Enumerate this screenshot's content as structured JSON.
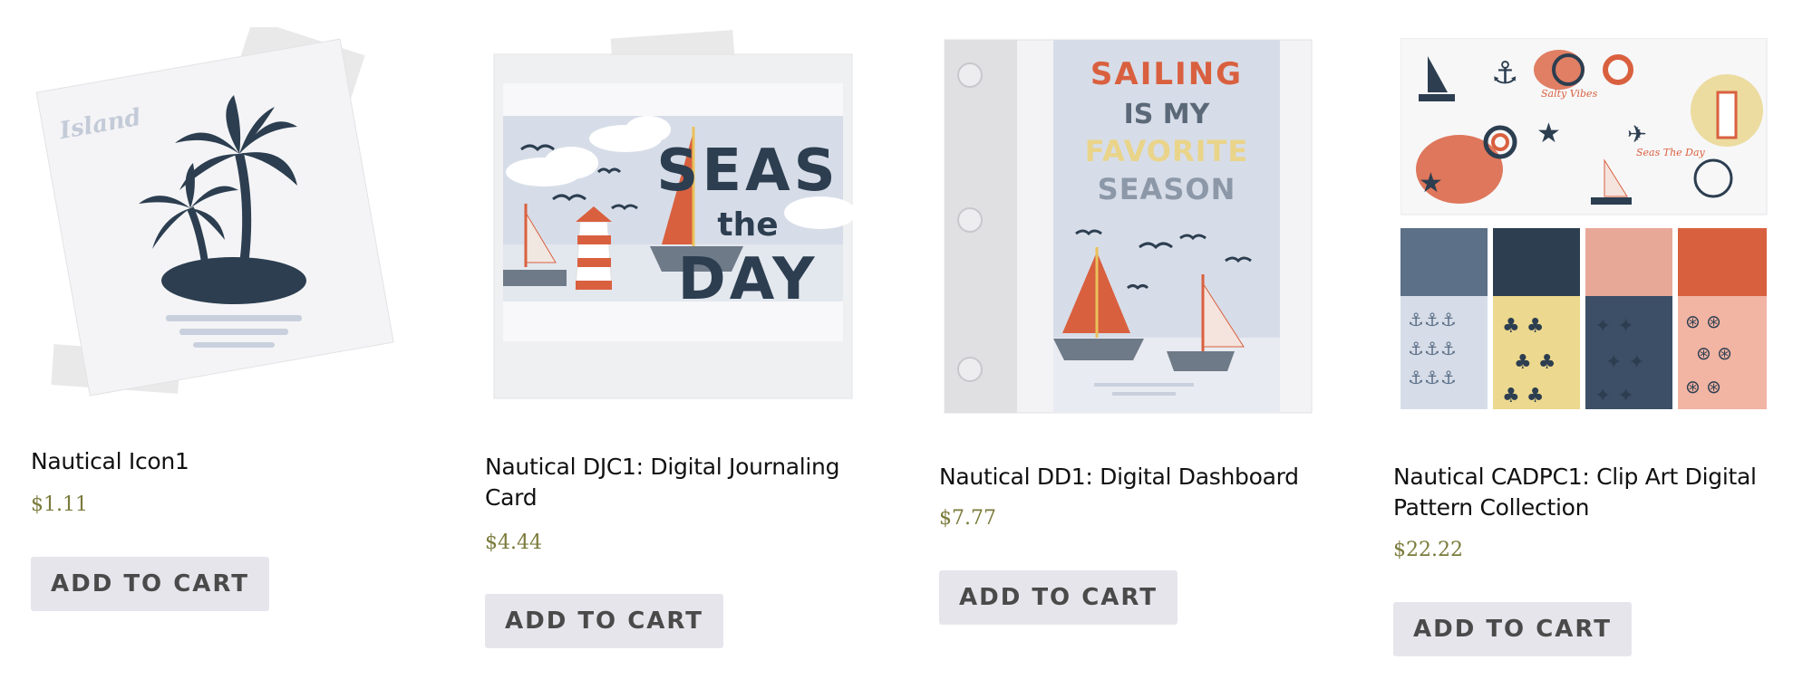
{
  "products": [
    {
      "title": "Nautical Icon1",
      "price": "$1.11",
      "button": "ADD TO CART",
      "image_text": "Island"
    },
    {
      "title": "Nautical DJC1: Digital Journaling Card",
      "price": "$4.44",
      "button": "ADD TO CART",
      "image_text": {
        "line1": "SEAS",
        "line2": "the",
        "line3": "DAY"
      }
    },
    {
      "title": "Nautical DD1: Digital Dashboard",
      "price": "$7.77",
      "button": "ADD TO CART",
      "image_text": {
        "line1": "SAILING",
        "line2": "IS MY",
        "line3": "FAVORITE",
        "line4": "SEASON"
      }
    },
    {
      "title": "Nautical CADPC1: Clip Art Digital Pattern Collection",
      "price": "$22.22",
      "button": "ADD TO CART",
      "image_text": {
        "label1": "Salty Vibes",
        "label2": "Seas The Day"
      }
    }
  ],
  "colors": {
    "navy": "#2c3e50",
    "coral": "#d9603f",
    "sand": "#e9d48a",
    "sky": "#d7dde8",
    "price": "#7a7a3c",
    "button_bg": "#e7e5ec",
    "button_text": "#4a4a4a"
  }
}
